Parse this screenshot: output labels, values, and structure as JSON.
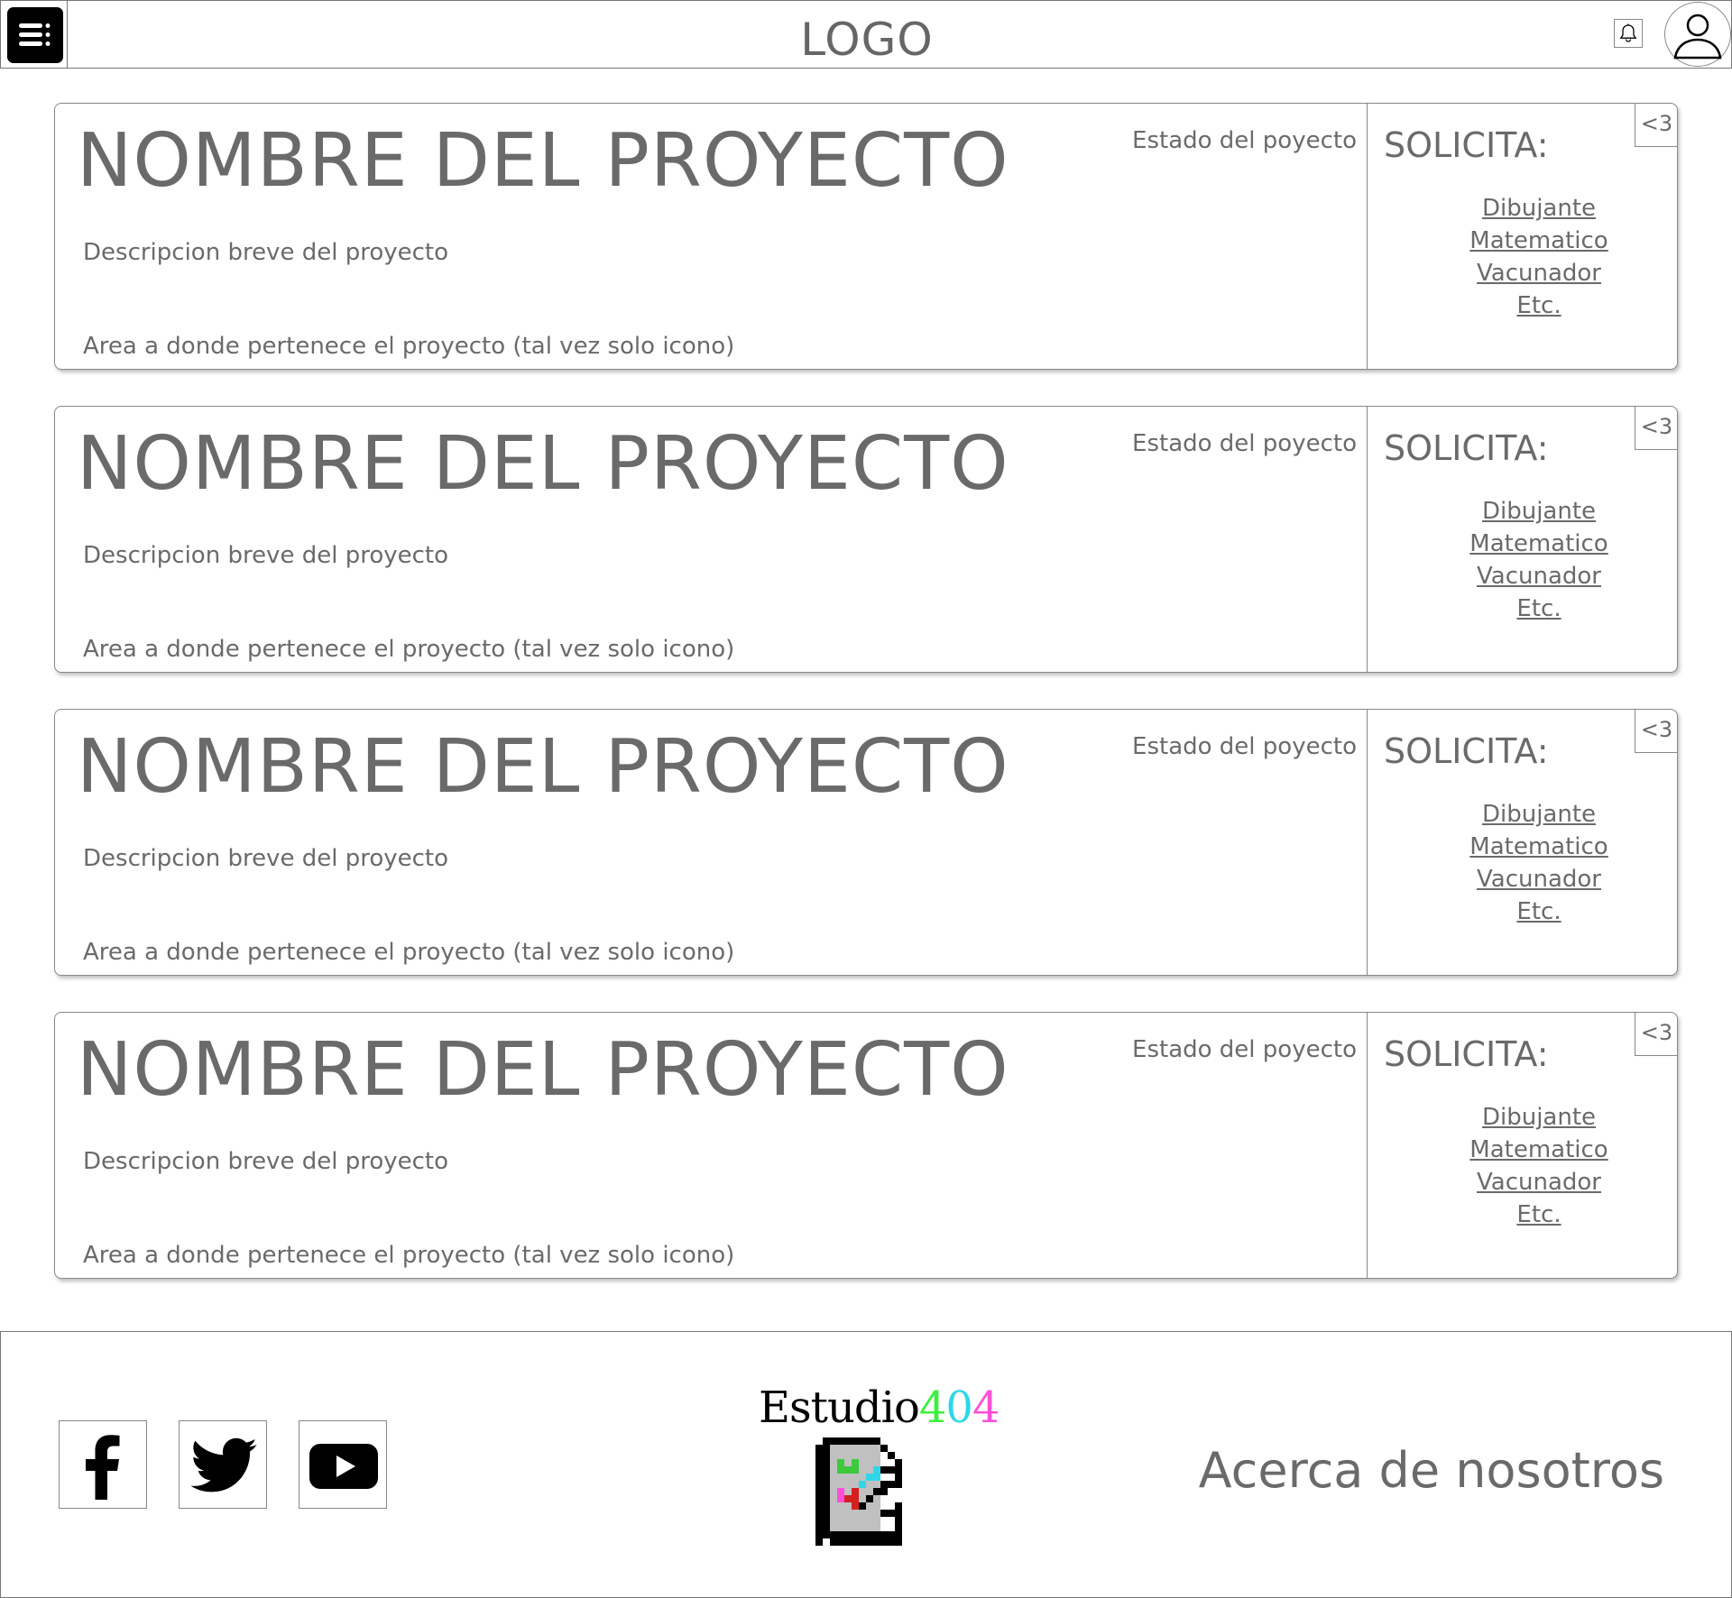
{
  "header": {
    "logo": "LOGO",
    "icons": {
      "menu": "menu-icon",
      "bell": "bell-icon",
      "avatar": "user-icon"
    }
  },
  "projects": [
    {
      "title": "NOMBRE DEL PROYECTO",
      "status": "Estado del poyecto",
      "description": "Descripcion breve del proyecto",
      "area": "Area a donde pertenece el proyecto (tal vez solo icono)",
      "solicita_label": "SOLICITA:",
      "roles": [
        "Dibujante",
        "Matematico",
        "Vacunador",
        "Etc."
      ],
      "like": "<3"
    },
    {
      "title": "NOMBRE DEL PROYECTO",
      "status": "Estado del poyecto",
      "description": "Descripcion breve del proyecto",
      "area": "Area a donde pertenece el proyecto (tal vez solo icono)",
      "solicita_label": "SOLICITA:",
      "roles": [
        "Dibujante",
        "Matematico",
        "Vacunador",
        "Etc."
      ],
      "like": "<3"
    },
    {
      "title": "NOMBRE DEL PROYECTO",
      "status": "Estado del poyecto",
      "description": "Descripcion breve del proyecto",
      "area": "Area a donde pertenece el proyecto (tal vez solo icono)",
      "solicita_label": "SOLICITA:",
      "roles": [
        "Dibujante",
        "Matematico",
        "Vacunador",
        "Etc."
      ],
      "like": "<3"
    },
    {
      "title": "NOMBRE DEL PROYECTO",
      "status": "Estado del poyecto",
      "description": "Descripcion breve del proyecto",
      "area": "Area a donde pertenece el proyecto (tal vez solo icono)",
      "solicita_label": "SOLICITA:",
      "roles": [
        "Dibujante",
        "Matematico",
        "Vacunador",
        "Etc."
      ],
      "like": "<3"
    }
  ],
  "footer": {
    "social": [
      "facebook-icon",
      "twitter-icon",
      "youtube-icon"
    ],
    "brand_text": "Estudio",
    "brand_digits": [
      "4",
      "0",
      "4"
    ],
    "brand_colors": [
      "#3cf13c",
      "#2fd6e8",
      "#ff4fd8"
    ],
    "about": "Acerca de nosotros"
  }
}
